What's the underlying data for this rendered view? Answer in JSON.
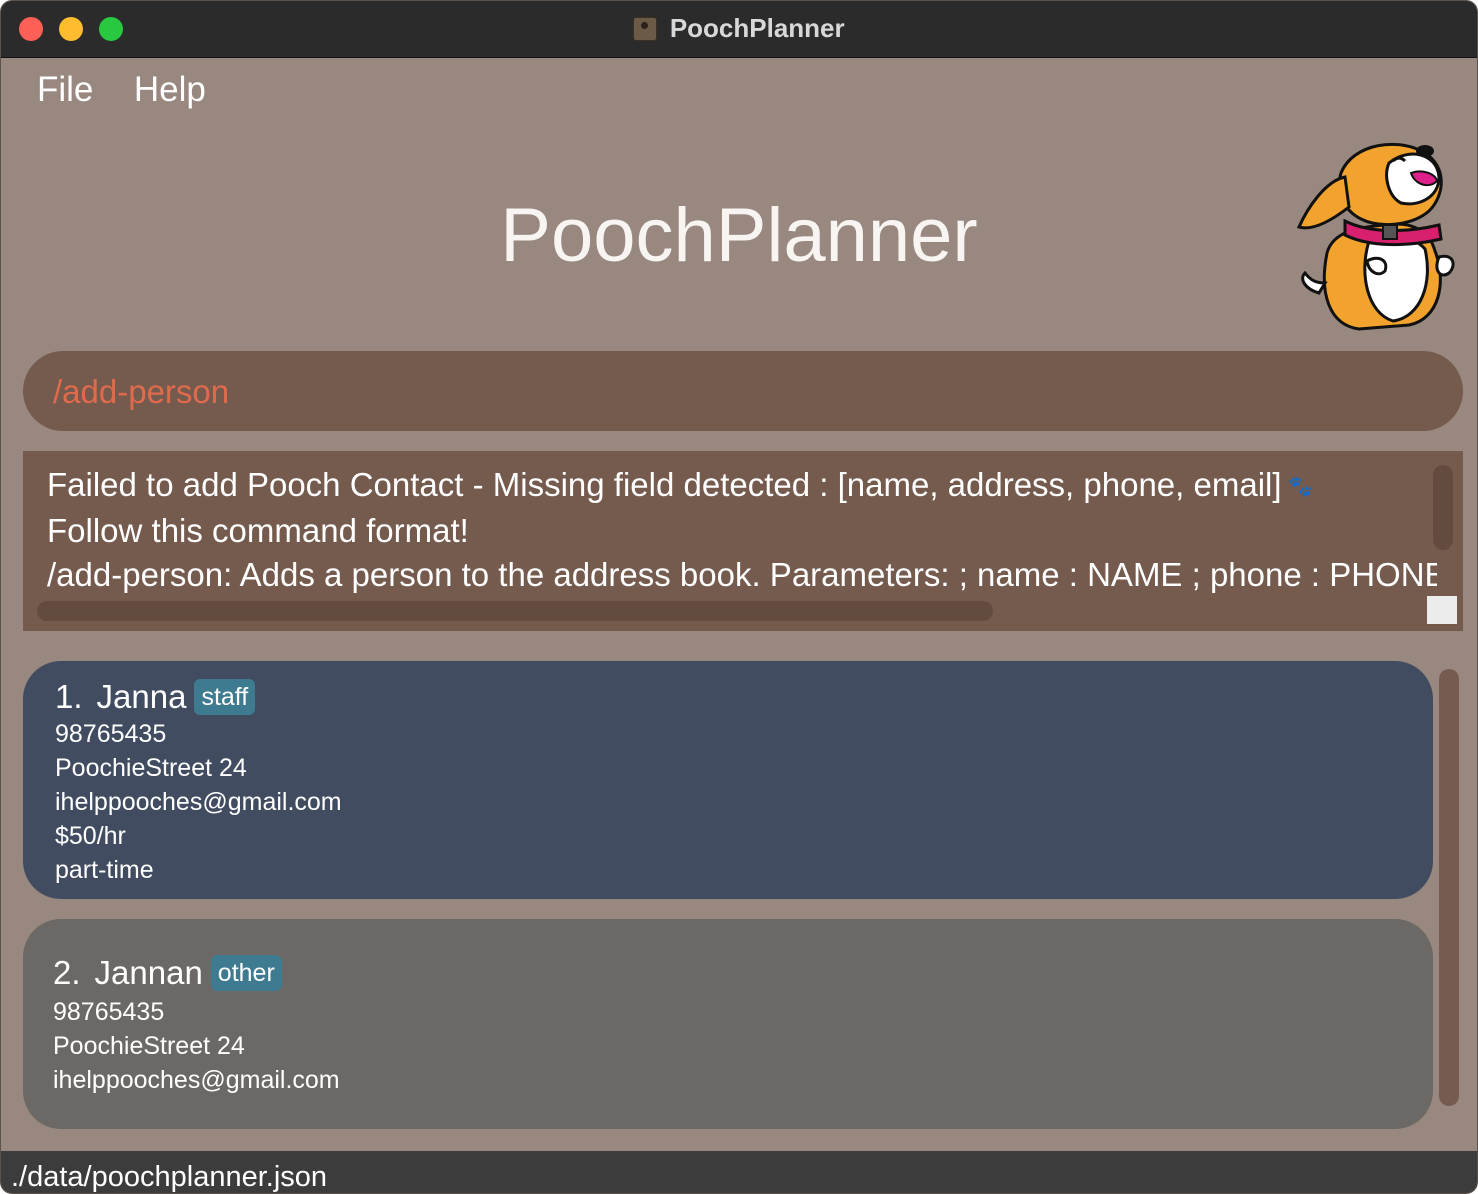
{
  "window": {
    "title": "PoochPlanner"
  },
  "menu": {
    "items": [
      "File",
      "Help"
    ]
  },
  "app": {
    "heading": "PoochPlanner"
  },
  "command": {
    "value": "/add-person"
  },
  "result": {
    "lines": [
      "Failed to add Pooch Contact - Missing field detected : [name, address, phone, email]",
      "Follow this command format!",
      "/add-person: Adds a person to the address book. Parameters: ; name : NAME ; phone : PHONE ; e"
    ]
  },
  "contacts": [
    {
      "index": "1.",
      "name": "Janna",
      "tag": "staff",
      "phone": "98765435",
      "address": "PoochieStreet 24",
      "email": "ihelppooches@gmail.com",
      "salary": "$50/hr",
      "employment": "part-time"
    },
    {
      "index": "2.",
      "name": "Jannan",
      "tag": "other",
      "phone": "98765435",
      "address": "PoochieStreet 24",
      "email": "ihelppooches@gmail.com"
    }
  ],
  "status": {
    "file_path": "./data/poochplanner.json"
  },
  "colors": {
    "background": "#98887f",
    "command_text": "#e06a4c",
    "panel": "#755a4e",
    "staff_card": "#414c60",
    "other_card": "#6c6865",
    "tag": "#3e7b91"
  },
  "icons": [
    "close-icon",
    "minimize-icon",
    "maximize-icon",
    "app-icon",
    "dog-mascot-icon",
    "paw-icon"
  ]
}
